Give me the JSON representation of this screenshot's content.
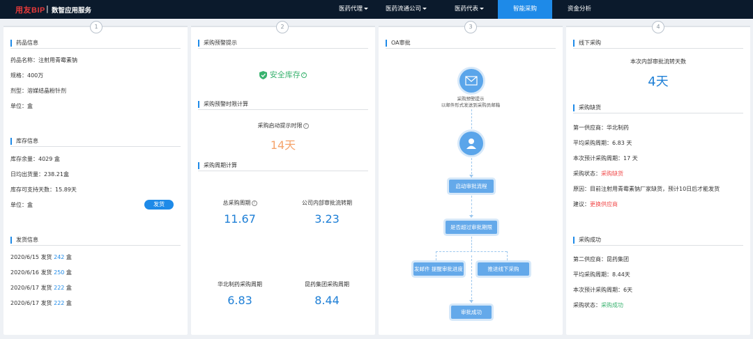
{
  "header": {
    "brand": "用友BIP",
    "brand_sep": "|",
    "brand_sub": "数智应用服务",
    "nav": [
      {
        "label": "医药代理",
        "dropdown": true
      },
      {
        "label": "医药流通公司",
        "dropdown": true
      },
      {
        "label": "医药代表",
        "dropdown": true
      },
      {
        "label": "智能采购",
        "dropdown": false,
        "active": true
      },
      {
        "label": "资金分析",
        "dropdown": false
      }
    ]
  },
  "cards": [
    {
      "step": "1",
      "drug_info": {
        "title": "药品信息",
        "name": "药品名称：注射用青霉素钠",
        "spec": "规格：400万",
        "form": "剂型：溶媒结晶粉针剂",
        "unit": "单位：盒"
      },
      "stock_info": {
        "title": "库存信息",
        "remain": "库存余量：4029 盒",
        "daily": "日均出货量：238.21盒",
        "days": "库存可支持天数：15.89天",
        "unit": "单位：盒",
        "ship_button": "发货"
      },
      "ship_info": {
        "title": "发货信息",
        "rows": [
          {
            "date": "2020/6/15 发货 ",
            "qty": "242",
            "unit": " 盒"
          },
          {
            "date": "2020/6/16 发货 ",
            "qty": "250",
            "unit": " 盒"
          },
          {
            "date": "2020/6/17 发货 ",
            "qty": "222",
            "unit": " 盒"
          },
          {
            "date": "2020/6/17 发货 ",
            "qty": "222",
            "unit": " 盒"
          }
        ]
      }
    },
    {
      "step": "2",
      "warn_title": "采购预警提示",
      "safe_stock": "安全库存",
      "time_title": "采购预警时限计算",
      "start_label": "采购启动提示时限",
      "start_value": "14天",
      "cycle_title": "采购周期计算",
      "total_label": "总采购周期",
      "total_value": "11.67",
      "internal_label": "公司内部审批流转期",
      "internal_value": "3.23",
      "huabei_label": "华北制药采购周期",
      "huabei_value": "6.83",
      "kunyao_label": "昆药集团采购周期",
      "kunyao_value": "8.44"
    },
    {
      "step": "3",
      "title": "OA审批",
      "mail_line1": "采购预警提示",
      "mail_line2": "以邮件形式发送到采购员邮箱",
      "box_start": "启动审批流程",
      "box_check": "是否超过审批期限",
      "box_mail": "发邮件 提醒审批进度",
      "box_offline": "推进线下采购",
      "box_success": "审批成功"
    },
    {
      "step": "4",
      "offline_title": "线下采购",
      "days_label": "本次内部审批流转天数",
      "days_value": "4天",
      "short_title": "采购缺货",
      "s1": "第一供应商：华北制药",
      "s2": "平均采购周期：6.83 天",
      "s3": "本次预计采购周期：17 天",
      "s4_label": "采购状态：",
      "s4_value": "采购缺货",
      "s5": "原因：目前注射用青霉素钠厂家缺货，预计10日后才能发货",
      "s6_label": "建议：",
      "s6_value": "更换供应商",
      "ok_title": "采购成功",
      "o1": "第二供应商：昆药集团",
      "o2": "平均采购周期：8.44天",
      "o3": "本次预计采购周期：6天",
      "o4_label": "采购状态：",
      "o4_value": "采购成功"
    }
  ]
}
